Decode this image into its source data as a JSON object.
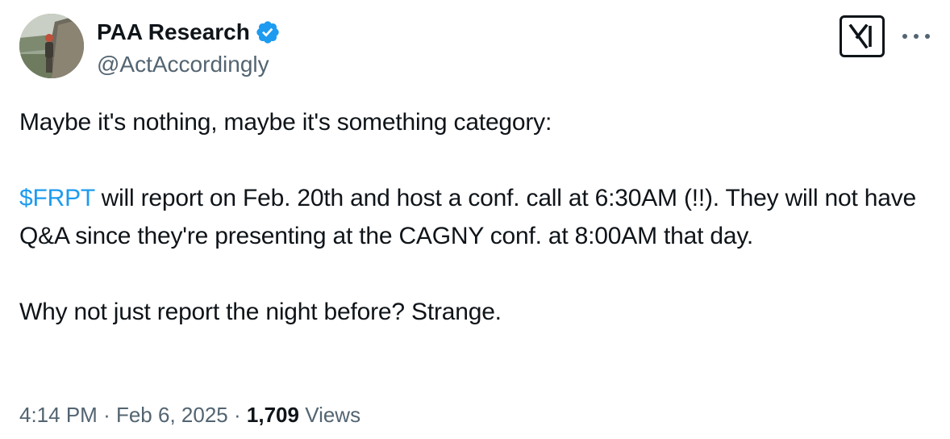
{
  "author": {
    "name": "PAA Research",
    "handle": "@ActAccordingly",
    "verified": true
  },
  "tweet": {
    "line1": "Maybe it's nothing, maybe it's something category:",
    "cashtag": "$FRPT",
    "paragraph2": " will report on Feb. 20th and host a conf. call at 6:30AM (!!). They will not have Q&A since they're presenting at the CAGNY conf. at 8:00AM that day.",
    "paragraph3": "Why not just report the night  before? Strange."
  },
  "meta": {
    "time": "4:14 PM",
    "separator": "·",
    "date": "Feb 6, 2025",
    "views_count": "1,709",
    "views_label": "Views"
  },
  "icons": {
    "verified": "verified-badge-icon",
    "brand": "x-logo-icon",
    "more": "more-options-icon"
  },
  "colors": {
    "accent": "#1d9bf0",
    "text": "#0f1419",
    "muted": "#536471"
  }
}
